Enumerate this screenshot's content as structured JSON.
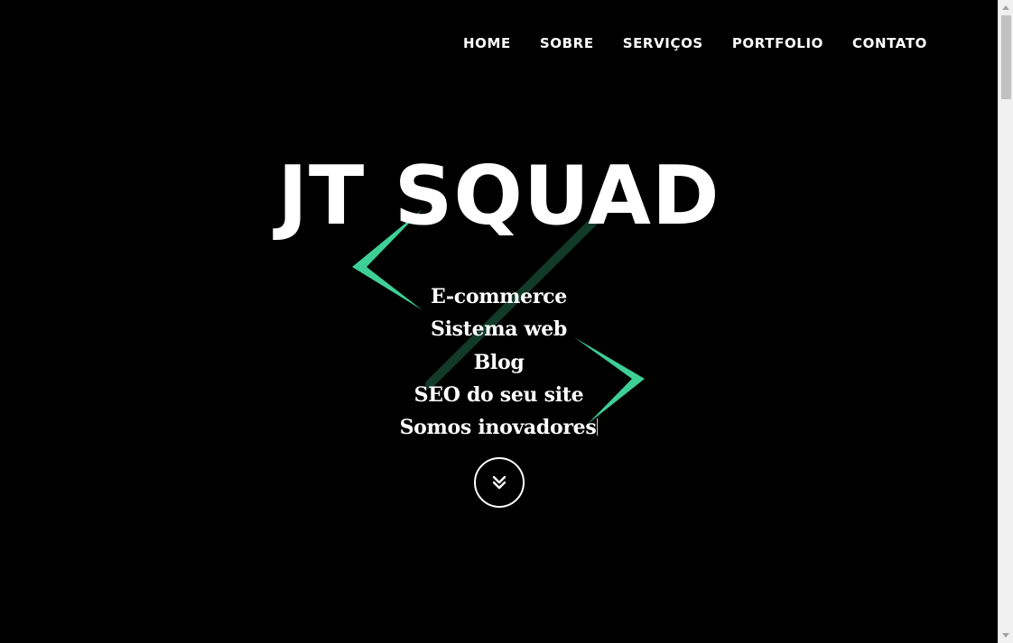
{
  "nav": {
    "items": [
      {
        "label": "HOME"
      },
      {
        "label": "SOBRE"
      },
      {
        "label": "SERVIÇOS"
      },
      {
        "label": "PORTFOLIO"
      },
      {
        "label": "CONTATO"
      }
    ]
  },
  "hero": {
    "title": "JT SQUAD",
    "services": [
      "E-commerce",
      "Sistema web",
      "Blog",
      "SEO do seu site",
      "Somos inovadores"
    ]
  },
  "scroll_button": {
    "icon": "double-chevron-down-icon"
  },
  "colors": {
    "background": "#000000",
    "text": "#ffffff",
    "accent": "#3ecf97",
    "accent_dark": "#123a2b"
  },
  "scrollbar": {
    "scroll_position": 0.0
  }
}
